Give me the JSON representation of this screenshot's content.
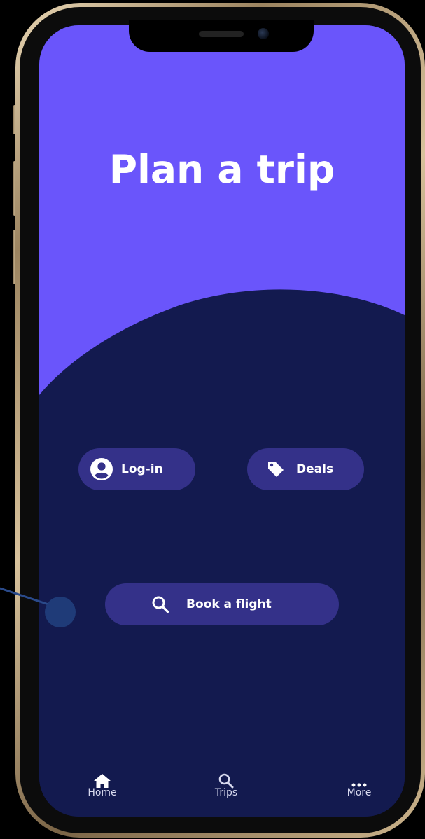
{
  "screen": {
    "title": "Plan a trip",
    "colors": {
      "header_purple": "#6a55fb",
      "body_navy": "#131a4f",
      "pill_bg": "#343189",
      "text": "#ffffff"
    }
  },
  "actions": {
    "login": {
      "label": "Log-in",
      "icon": "account-circle-icon"
    },
    "deals": {
      "label": "Deals",
      "icon": "tag-icon"
    },
    "book": {
      "label": "Book a flight",
      "icon": "search-icon"
    }
  },
  "tabbar": {
    "items": [
      {
        "label": "Home",
        "icon": "home-icon"
      },
      {
        "label": "Trips",
        "icon": "search-icon"
      },
      {
        "label": "More",
        "icon": "more-dots-icon"
      }
    ]
  }
}
